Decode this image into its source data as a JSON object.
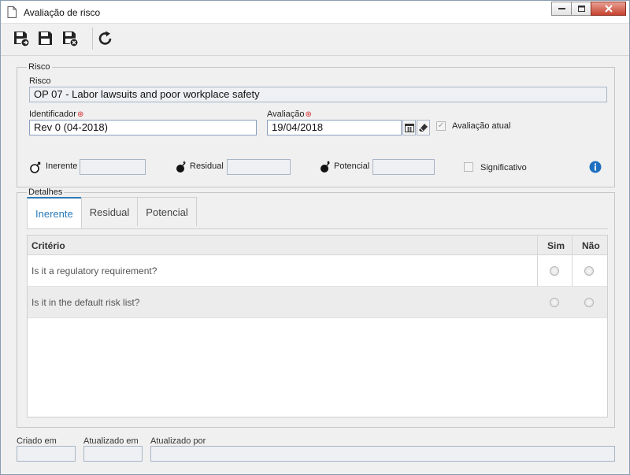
{
  "window": {
    "title": "Avaliação de risco",
    "controls": [
      "minimize",
      "maximize",
      "close"
    ]
  },
  "toolbar": {
    "buttons": [
      {
        "icon": "save-new-icon"
      },
      {
        "icon": "save-icon"
      },
      {
        "icon": "save-close-icon"
      },
      {
        "icon": "refresh-icon"
      }
    ]
  },
  "risco": {
    "legend": "Risco",
    "risco_label": "Risco",
    "risco_value": "OP 07 - Labor lawsuits and poor workplace safety",
    "identificador_label": "Identificador",
    "identificador_value": "Rev 0 (04-2018)",
    "avaliacao_label": "Avaliação",
    "avaliacao_value": "19/04/2018",
    "avaliacao_atual_label": "Avaliação atual",
    "avaliacao_atual_checked": true,
    "inerente_label": "Inerente",
    "inerente_value": "",
    "residual_label": "Residual",
    "residual_value": "",
    "potencial_label": "Potencial",
    "potencial_value": "",
    "significativo_label": "Significativo",
    "significativo_checked": false
  },
  "detalhes": {
    "legend": "Detalhes",
    "tabs": [
      {
        "label": "Inerente",
        "active": true
      },
      {
        "label": "Residual",
        "active": false
      },
      {
        "label": "Potencial",
        "active": false
      }
    ],
    "columns": {
      "criterio": "Critério",
      "sim": "Sim",
      "nao": "Não"
    },
    "rows": [
      {
        "criterio": "Is it a regulatory requirement?",
        "sim": false,
        "nao": false
      },
      {
        "criterio": "Is it in the default risk list?",
        "sim": false,
        "nao": false
      }
    ]
  },
  "footer": {
    "criado_em_label": "Criado em",
    "criado_em_value": "",
    "atualizado_em_label": "Atualizado em",
    "atualizado_em_value": "",
    "atualizado_por_label": "Atualizado por",
    "atualizado_por_value": ""
  },
  "colors": {
    "accent": "#2a7ab8",
    "required": "#d42a2a",
    "info": "#1e6fc0"
  }
}
